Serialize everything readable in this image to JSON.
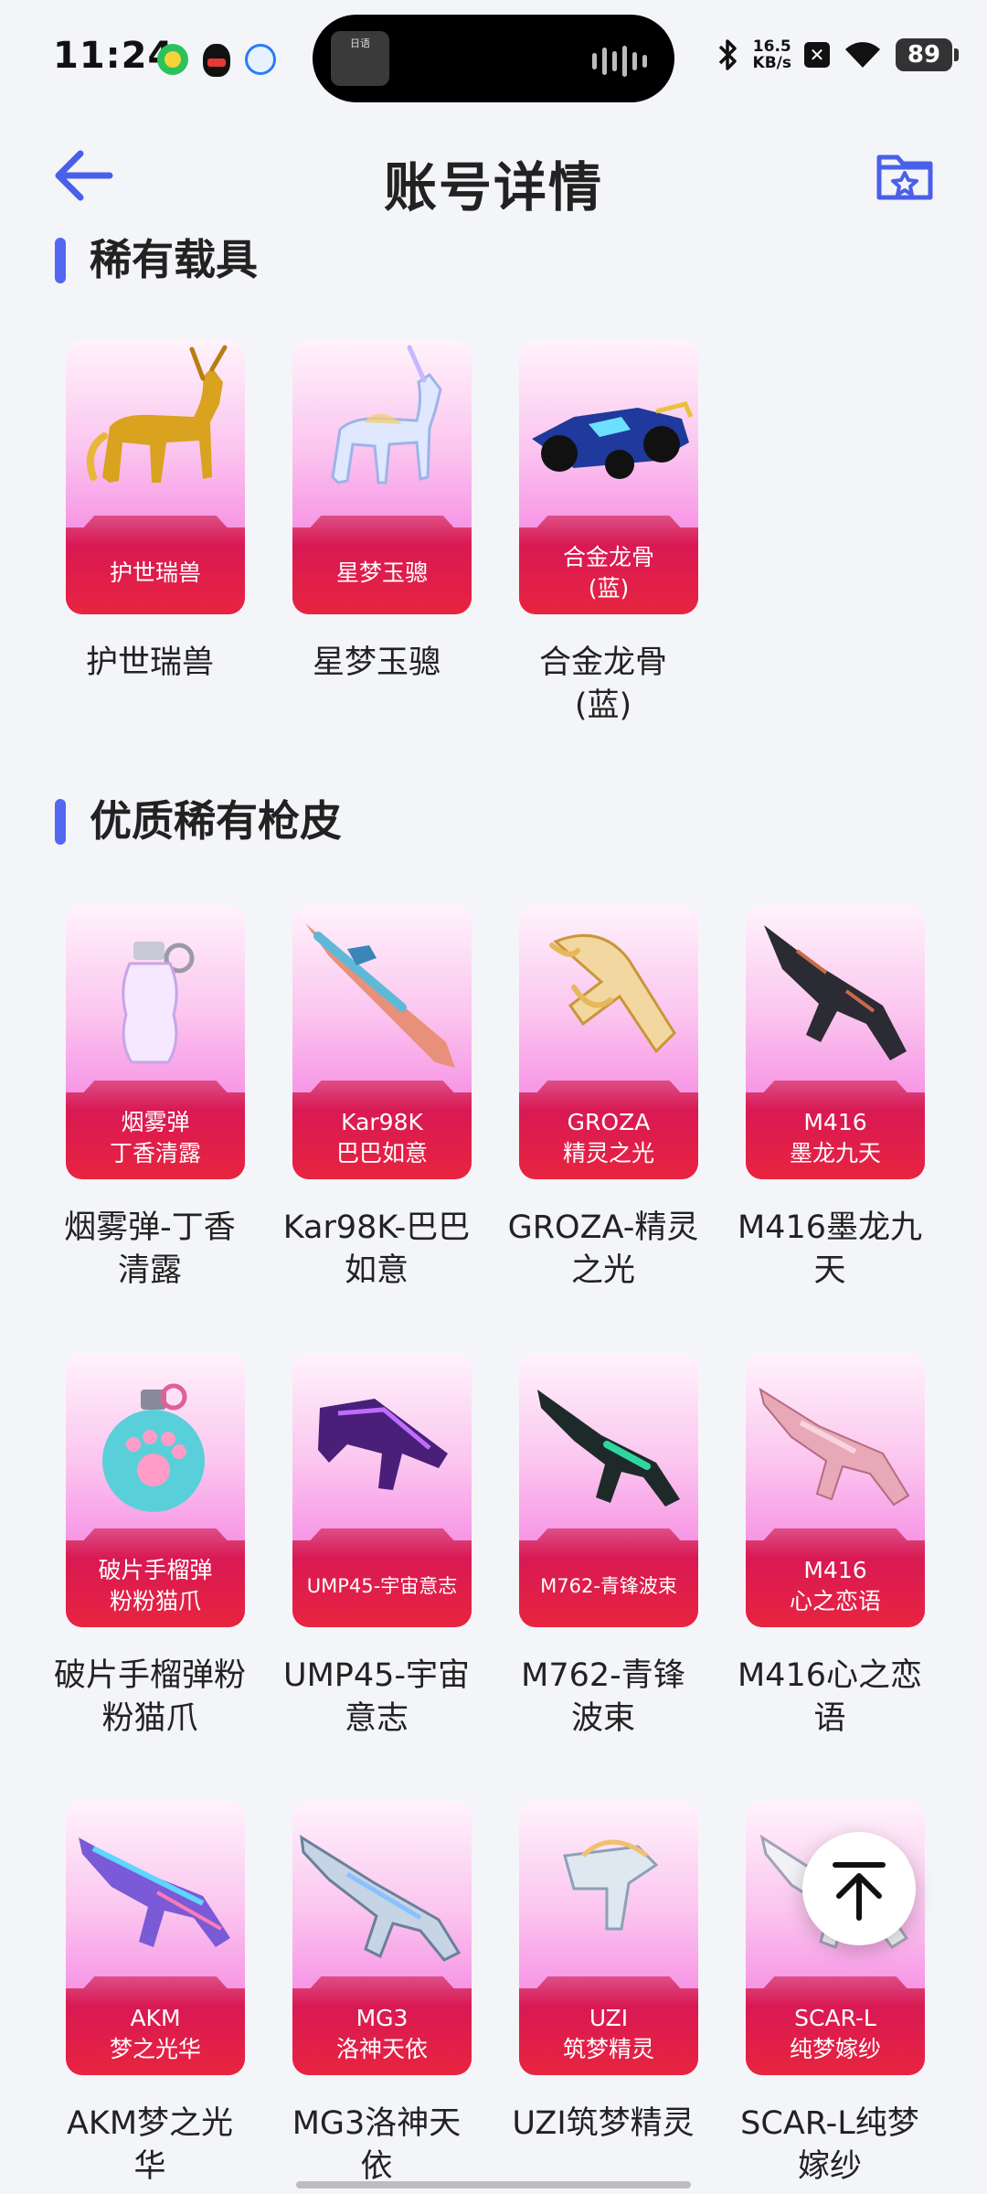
{
  "status_bar": {
    "time": "11:24",
    "island_thumb_text": "日语",
    "net_speed_value": "16.5",
    "net_speed_unit": "KB/s",
    "battery": "89"
  },
  "header": {
    "title": "账号详情",
    "back_icon": "arrow-left-icon",
    "favorite_icon": "folder-star-icon",
    "accent_color": "#5467f0"
  },
  "sections": [
    {
      "title": "稀有载具",
      "items": [
        {
          "card_label": "护世瑞兽",
          "name": "护世瑞兽",
          "icon": "golden-qilin-icon"
        },
        {
          "card_label": "星梦玉骢",
          "name": "星梦玉骢",
          "icon": "unicorn-horse-icon"
        },
        {
          "card_label": "合金龙骨\n(蓝)",
          "name": "合金龙骨\n(蓝)",
          "icon": "race-car-icon"
        }
      ]
    },
    {
      "title": "优质稀有枪皮",
      "items": [
        {
          "card_label": "烟雾弹\n丁香清露",
          "name": "烟雾弹-丁香\n清露",
          "icon": "smoke-grenade-icon"
        },
        {
          "card_label": "Kar98K\n巴巴如意",
          "name": "Kar98K-巴巴\n如意",
          "icon": "sniper-rifle-icon"
        },
        {
          "card_label": "GROZA\n精灵之光",
          "name": "GROZA-精灵\n之光",
          "icon": "ornate-rifle-icon"
        },
        {
          "card_label": "M416\n墨龙九天",
          "name": "M416墨龙九\n天",
          "icon": "assault-rifle-icon"
        },
        {
          "card_label": "破片手榴弹\n粉粉猫爪",
          "name": "破片手榴弹粉\n粉猫爪",
          "icon": "frag-grenade-icon"
        },
        {
          "card_label": "UMP45-宇宙意志",
          "name": "UMP45-宇宙\n意志",
          "icon": "smg-icon"
        },
        {
          "card_label": "M762-青锋波束",
          "name": "M762-青锋\n波束",
          "icon": "rifle-icon"
        },
        {
          "card_label": "M416\n心之恋语",
          "name": "M416心之恋\n语",
          "icon": "pink-rifle-icon"
        },
        {
          "card_label": "AKM\n梦之光华",
          "name": "AKM梦之光\n华",
          "icon": "akm-rifle-icon"
        },
        {
          "card_label": "MG3\n洛神天依",
          "name": "MG3洛神天\n依",
          "icon": "machine-gun-icon"
        },
        {
          "card_label": "UZI\n筑梦精灵",
          "name": "UZI筑梦精灵",
          "icon": "uzi-icon"
        },
        {
          "card_label": "SCAR-L\n纯梦嫁纱",
          "name": "SCAR-L纯梦\n嫁纱",
          "icon": "scar-rifle-icon"
        }
      ]
    }
  ],
  "scroll_top": {
    "icon": "arrow-up-to-top-icon"
  }
}
